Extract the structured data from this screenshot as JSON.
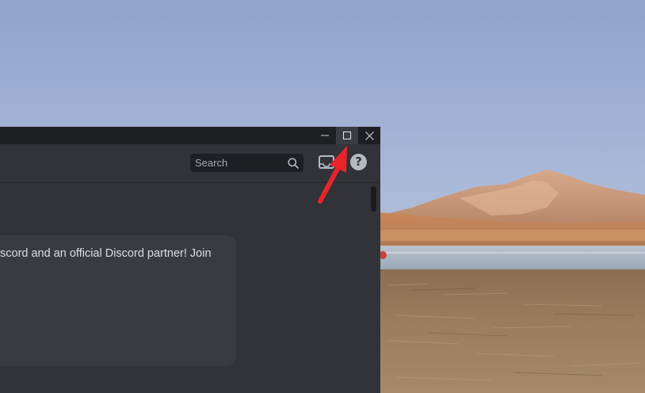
{
  "window": {
    "controls": {
      "minimize": "minimize-icon",
      "maximize": "maximize-icon",
      "close": "close-icon"
    }
  },
  "toolbar": {
    "search_label": "Search",
    "search_icon": "search-icon",
    "inbox_icon": "inbox-icon",
    "help_icon": "help-icon",
    "help_glyph": "?"
  },
  "main": {
    "card_text": "scord and an official Discord partner! Join"
  },
  "annotation": {
    "arrow_color": "#e8242a",
    "arrow_target": "maximize-button"
  },
  "colors": {
    "window_bg": "#313338",
    "titlebar_bg": "#1e1f22",
    "search_bg": "#1e1f22",
    "card_bg": "#3a3b41",
    "text": "#dbdee1",
    "muted_text": "#a5a8ae"
  }
}
